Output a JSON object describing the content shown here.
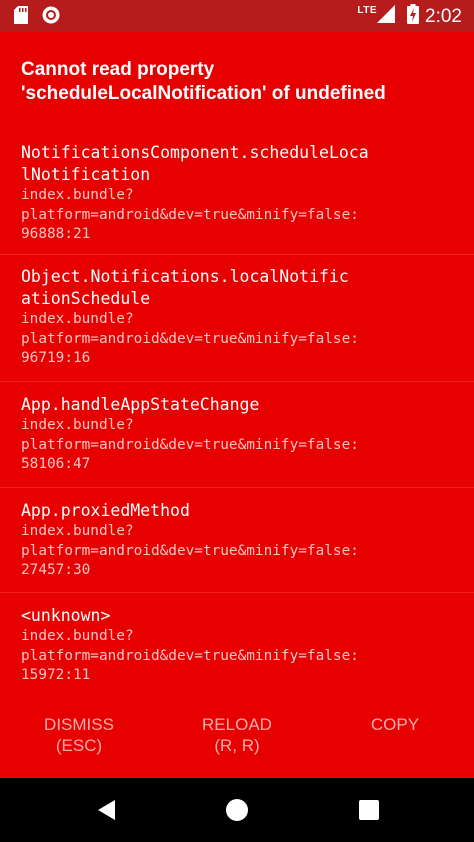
{
  "status_bar": {
    "network": "LTE",
    "time": "2:02",
    "icons": [
      "sd-card-icon",
      "circle-app-icon",
      "lte-signal-icon",
      "battery-charging-icon"
    ]
  },
  "error": {
    "title_line1": "Cannot read property",
    "title_line2": "'scheduleLocalNotification' of undefined"
  },
  "stack": [
    {
      "method_lines": [
        "NotificationsComponent.scheduleLoca",
        "lNotification"
      ],
      "file": "index.bundle?",
      "params": "platform=android&dev=true&minify=false:",
      "position": "96888:21"
    },
    {
      "method_lines": [
        "Object.Notifications.localNotific",
        "ationSchedule"
      ],
      "file": "index.bundle?",
      "params": "platform=android&dev=true&minify=false:",
      "position": "96719:16"
    },
    {
      "method_lines": [
        "App.handleAppStateChange"
      ],
      "file": "index.bundle?",
      "params": "platform=android&dev=true&minify=false:",
      "position": "58106:47"
    },
    {
      "method_lines": [
        "App.proxiedMethod"
      ],
      "file": "index.bundle?",
      "params": "platform=android&dev=true&minify=false:",
      "position": "27457:30"
    },
    {
      "method_lines": [
        "<unknown>"
      ],
      "file": "index.bundle?",
      "params": "platform=android&dev=true&minify=false:",
      "position": "15972:11"
    }
  ],
  "buttons": {
    "dismiss": {
      "label": "DISMISS",
      "shortcut": "(ESC)"
    },
    "reload": {
      "label": "RELOAD",
      "shortcut": "(R, R)"
    },
    "copy": {
      "label": "COPY"
    }
  },
  "colors": {
    "background": "#e60000",
    "status_bar": "#b71c1c",
    "button_text": "#ffaaaa",
    "secondary_text": "#ffc4c4"
  }
}
